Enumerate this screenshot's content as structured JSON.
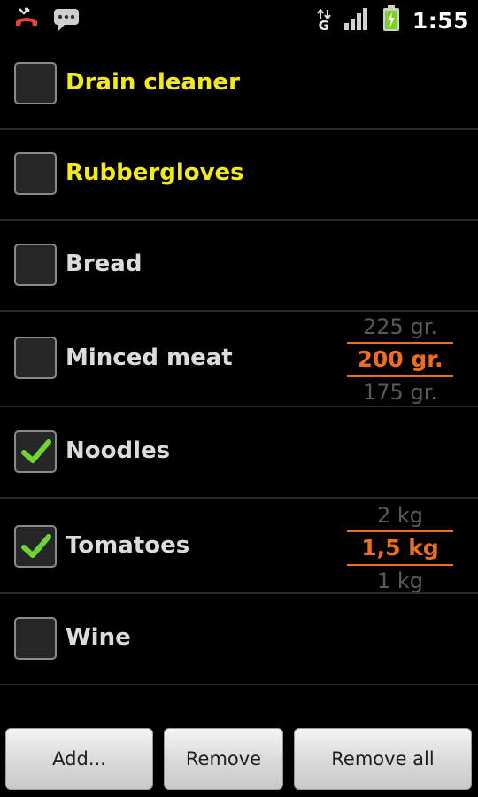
{
  "status_bar": {
    "left_icons": [
      "missed-call-icon",
      "sms-icon"
    ],
    "network_type": "G",
    "time": "1:55",
    "right_icons": [
      "data-activity-icon",
      "signal-icon",
      "battery-charging-icon"
    ]
  },
  "colors": {
    "background": "#000000",
    "highlight_yellow": "#f2ea1b",
    "quantity_orange": "#ee6d1e",
    "check_green": "#6fd335",
    "divider": "#2a2a2a"
  },
  "items": [
    {
      "label": "Drain cleaner",
      "checked": false,
      "highlighted": true
    },
    {
      "label": "Rubbergloves",
      "checked": false,
      "highlighted": true
    },
    {
      "label": "Bread",
      "checked": false,
      "highlighted": false
    },
    {
      "label": "Minced meat",
      "checked": false,
      "highlighted": false,
      "quantity": {
        "above": "225 gr.",
        "selected": "200 gr.",
        "below": "175 gr."
      }
    },
    {
      "label": "Noodles",
      "checked": true,
      "highlighted": false
    },
    {
      "label": "Tomatoes",
      "checked": true,
      "highlighted": false,
      "quantity": {
        "above": "2 kg",
        "selected": "1,5 kg",
        "below": "1 kg"
      }
    },
    {
      "label": "Wine",
      "checked": false,
      "highlighted": false
    }
  ],
  "buttons": {
    "add_label": "Add...",
    "remove_label": "Remove",
    "remove_all_label": "Remove all"
  }
}
